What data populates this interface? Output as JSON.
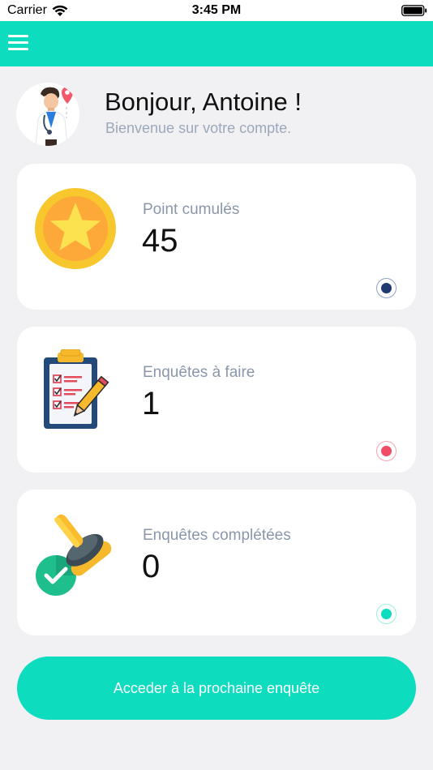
{
  "status_bar": {
    "carrier": "Carrier",
    "time": "3:45 PM"
  },
  "colors": {
    "accent": "#0ddcbf",
    "background": "#f1f1f3",
    "card": "#ffffff",
    "points_dot": "#1f3a70",
    "todo_dot": "#f04b67",
    "completed_dot": "#0ddcbf"
  },
  "header": {
    "greeting": "Bonjour, Antoine !",
    "subtitle": "Bienvenue sur votre compte."
  },
  "cards": [
    {
      "label": "Point cumulés",
      "value": "45",
      "icon": "star-coin-icon"
    },
    {
      "label": "Enquêtes à faire",
      "value": "1",
      "icon": "clipboard-checklist-icon"
    },
    {
      "label": "Enquêtes complétées",
      "value": "0",
      "icon": "stamp-check-icon"
    }
  ],
  "cta": {
    "label": "Acceder à la prochaine enquête"
  }
}
